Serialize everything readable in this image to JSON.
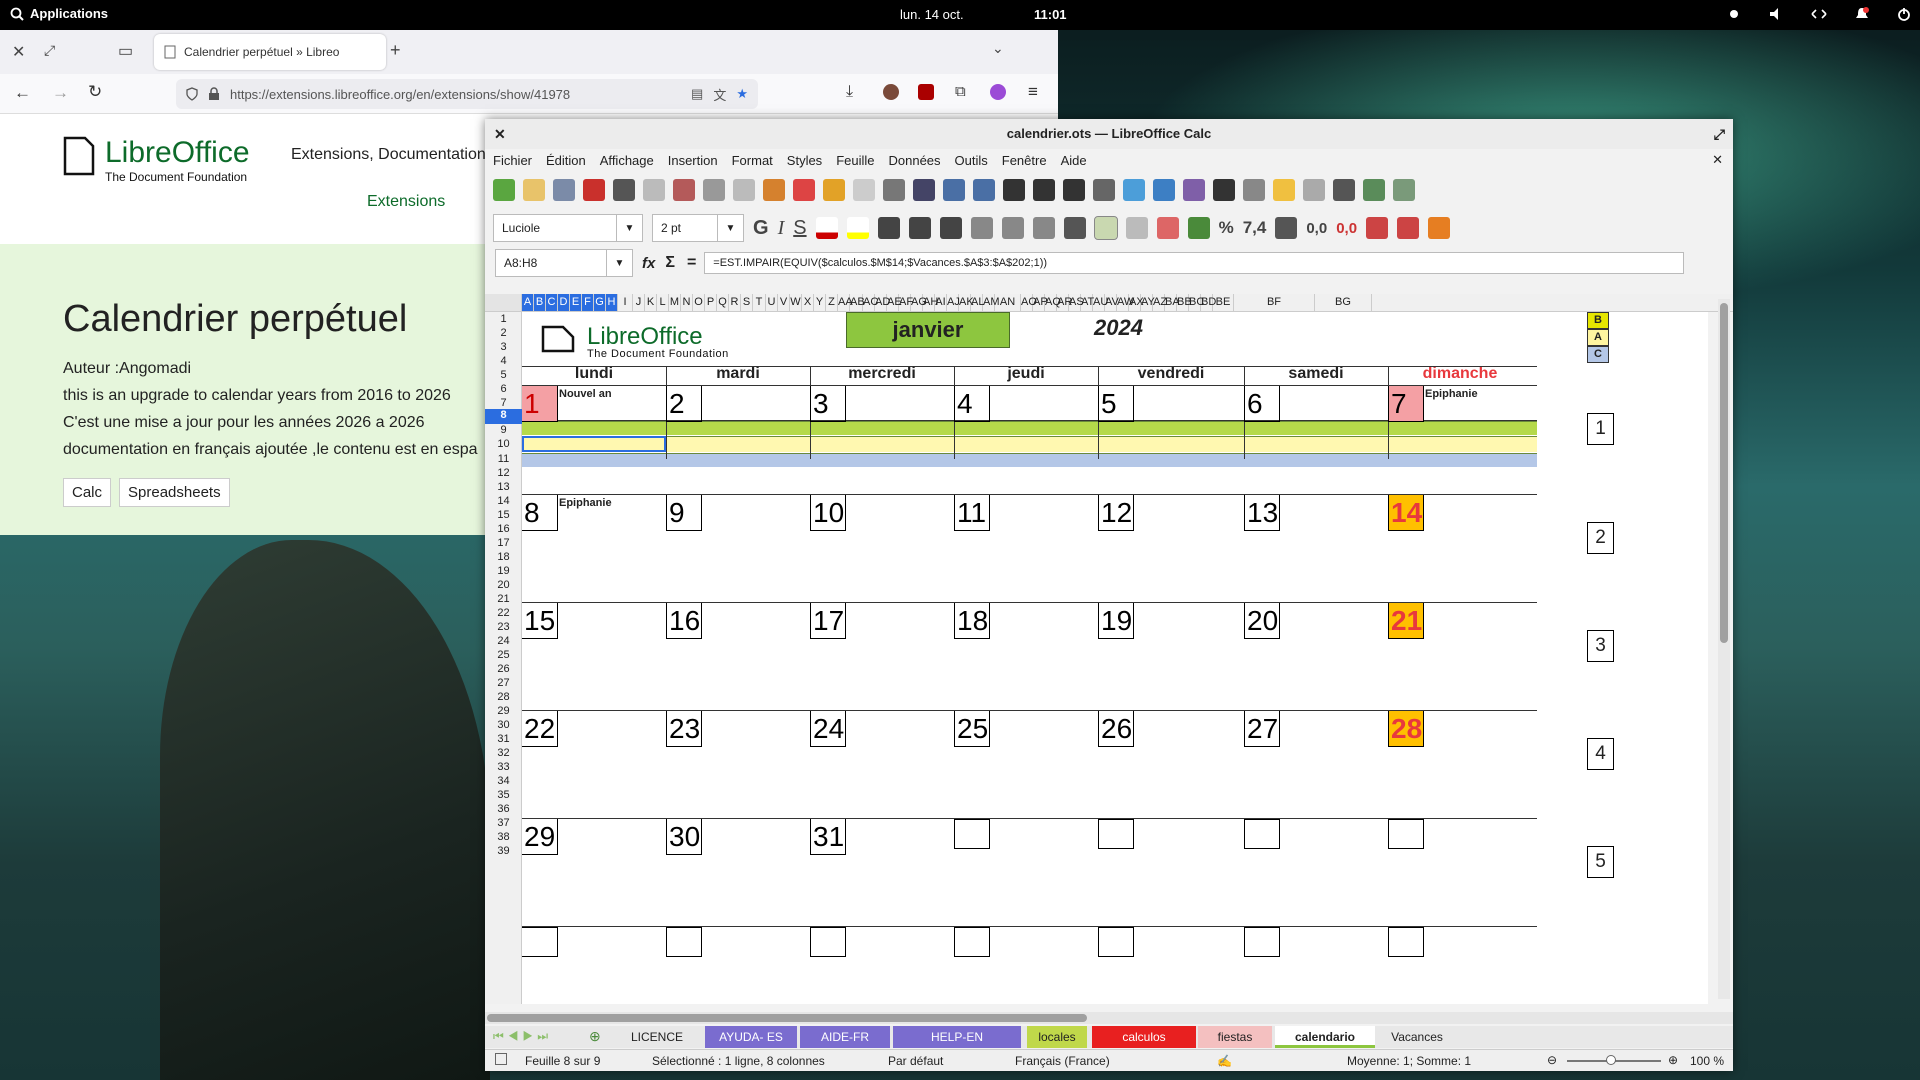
{
  "topbar": {
    "apps_label": "Applications",
    "date": "lun. 14 oct.",
    "time": "11:01"
  },
  "browser": {
    "tab_title": "Calendrier perpétuel » Libreo",
    "url": "https://extensions.libreoffice.org/en/extensions/show/41978",
    "logo_name": "LibreOffice",
    "logo_sub": "The Document Foundation",
    "nav_text": "Extensions, Documentation",
    "nav_link": "Extensions",
    "page_title": "Calendrier perpétuel",
    "lines": [
      "Auteur :Angomadi",
      "this is an upgrade to calendar years from 2016 to 2026",
      "C'est une mise a jour pour les années 2026 a 2026",
      "documentation en français ajoutée ,le contenu est en espa"
    ],
    "tags": [
      "Calc",
      "Spreadsheets"
    ]
  },
  "calc": {
    "window_title": "calendrier.ots — LibreOffice Calc",
    "menu": [
      "Fichier",
      "Édition",
      "Affichage",
      "Insertion",
      "Format",
      "Styles",
      "Feuille",
      "Données",
      "Outils",
      "Fenêtre",
      "Aide"
    ],
    "font_name": "Luciole",
    "font_size": "2 pt",
    "bold_glyph": "G",
    "italic_glyph": "I",
    "underline_glyph": "S",
    "name_box": "A8:H8",
    "formula": "=EST.IMPAIR(EQUIV($calculos.$M$14;$Vacances.$A$3:$A$202;1))",
    "columns": [
      "A",
      "B",
      "C",
      "D",
      "E",
      "F",
      "G",
      "H",
      "I",
      "J",
      "K",
      "L",
      "M",
      "N",
      "O",
      "P",
      "Q",
      "R",
      "S",
      "T",
      "U",
      "V",
      "W",
      "X",
      "Y",
      "Z",
      "AA",
      "AB",
      "AC",
      "AD",
      "AE",
      "AF",
      "AG",
      "AH",
      "AI",
      "AJ",
      "AK",
      "AL",
      "AM",
      "AN",
      "AO",
      "AP",
      "AQ",
      "AR",
      "AS",
      "AT",
      "AU",
      "AV",
      "AW",
      "AX",
      "AY",
      "AZ",
      "BA",
      "BB",
      "BC",
      "BD",
      "BE",
      "BF",
      "BG"
    ],
    "rows": [
      "1",
      "2",
      "3",
      "4",
      "5",
      "6",
      "7",
      "8",
      "9",
      "10",
      "11",
      "12",
      "13",
      "14",
      "15",
      "16",
      "17",
      "18",
      "19",
      "20",
      "21",
      "22",
      "23",
      "24",
      "25",
      "26",
      "27",
      "28",
      "29",
      "30",
      "31",
      "32",
      "33",
      "34",
      "35",
      "36",
      "37",
      "38",
      "39"
    ],
    "month": "janvier",
    "year": "2024",
    "legend": [
      "B",
      "A",
      "C"
    ],
    "weekdays": [
      "lundi",
      "mardi",
      "mercredi",
      "jeudi",
      "vendredi",
      "samedi",
      "dimanche"
    ],
    "weeks": [
      [
        "1",
        "2",
        "3",
        "4",
        "5",
        "6",
        "7"
      ],
      [
        "8",
        "9",
        "10",
        "11",
        "12",
        "13",
        "14"
      ],
      [
        "15",
        "16",
        "17",
        "18",
        "19",
        "20",
        "21"
      ],
      [
        "22",
        "23",
        "24",
        "25",
        "26",
        "27",
        "28"
      ],
      [
        "29",
        "30",
        "31",
        "",
        "",
        "",
        ""
      ],
      [
        "",
        "",
        "",
        "",
        "",
        "",
        ""
      ]
    ],
    "holidays": {
      "nouvel_an": "Nouvel an",
      "epiphanie_1": "Epiphanie",
      "epiphanie_2": "Epiphanie"
    },
    "week_numbers": [
      "1",
      "2",
      "3",
      "4",
      "5"
    ],
    "sheet_tabs": [
      "LICENCE",
      "AYUDA- ES",
      "AIDE-FR",
      "HELP-EN",
      "locales",
      "calculos",
      "fiestas",
      "calendario",
      "Vacances"
    ],
    "status": {
      "sheet": "Feuille 8 sur 9",
      "selection": "Sélectionné : 1 ligne, 8 colonnes",
      "style": "Par défaut",
      "language": "Français (France)",
      "sum": "Moyenne: 1; Somme: 1",
      "zoom": "100 %"
    },
    "colors": {
      "header_green": "#8dc63f",
      "row7_green": "#b5d94a",
      "row8_yellow": "#fff8b0",
      "row9_blue": "#b4c7e7",
      "sunday_red": "#e8383d",
      "sunday_orange": "#ffc000",
      "day1_pink": "#f4a0a4"
    }
  }
}
